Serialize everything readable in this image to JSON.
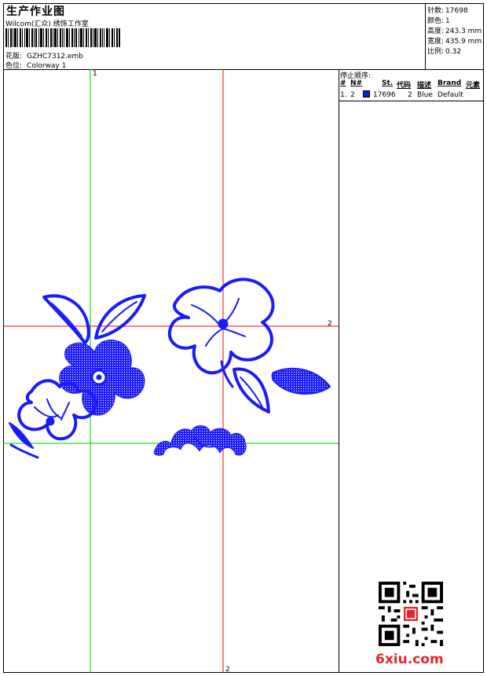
{
  "header": {
    "title": "生产作业图",
    "company": "Wilcom(汇众) 绣饰工作室",
    "design_label": "花版:",
    "design_value": "GZHC7312.emb",
    "colorway_label": "色位:",
    "colorway_value": "Colorway 1"
  },
  "stats": [
    {
      "label": "针数:",
      "value": "17698"
    },
    {
      "label": "颜色:",
      "value": "1"
    },
    {
      "label": "高度:",
      "value": "243.3 mm"
    },
    {
      "label": "宽度:",
      "value": "435.9 mm"
    },
    {
      "label": "比例:",
      "value": "0.32"
    }
  ],
  "guides": {
    "top_label": "1",
    "right_label": "2",
    "bottom_label": "2",
    "vertical_color": "#00cc00",
    "horizontal_color": "#ff0000"
  },
  "stop_sequence": {
    "title": "停止顺序:",
    "columns": [
      "#",
      "N#",
      "St.",
      "代码",
      "描述",
      "Brand",
      "元素"
    ],
    "rows": [
      {
        "index": "1.",
        "needle": "2",
        "stitches": "17696",
        "code": "2",
        "description": "Blue",
        "brand": "Default",
        "color": "#0020e0"
      }
    ]
  },
  "colors": {
    "stitch": "#1a1aff",
    "swatch": "#0020e0",
    "watermark": "#e8252a"
  },
  "watermark": {
    "site": "6xiu.com"
  }
}
